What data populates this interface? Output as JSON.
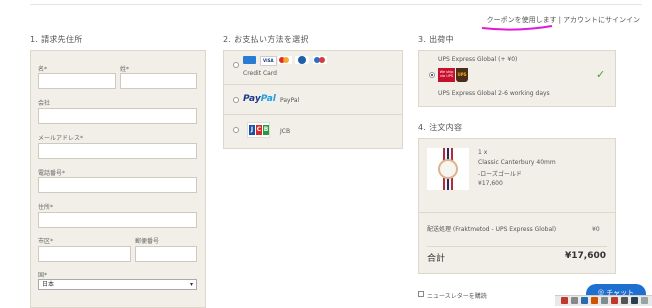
{
  "top_links": {
    "coupon": "クーポンを使用します",
    "separator": "|",
    "signin": "アカウントにサインイン"
  },
  "sections": {
    "billing": "1. 請求先住所",
    "payment": "2. お支払い方法を選択",
    "shipping": "3. 出荷中",
    "order": "4. 注文内容"
  },
  "billing_form": {
    "first_name": "名*",
    "last_name": "姓*",
    "company": "会社",
    "email": "メールアドレス*",
    "phone": "電話番号*",
    "address": "住所*",
    "city": "市区*",
    "zip": "郵便番号",
    "country": "国*",
    "country_value": "日本"
  },
  "payment_options": [
    {
      "label": "Credit Card",
      "selected": false,
      "logos": [
        "amex-icon",
        "visa-icon",
        "mastercard-icon",
        "diners-icon",
        "jcb-mini-icon"
      ]
    },
    {
      "label": "PayPal",
      "logo_text": "PayPal",
      "selected": false
    },
    {
      "label": "JCB",
      "logo_text": "JCB",
      "selected": false
    }
  ],
  "shipping": {
    "method_title": "UPS Express Global (+ ¥0)",
    "detail": "UPS Express Global 2-6 working days",
    "badge_text": "We ship via UPS",
    "ups_text": "UPS",
    "check": "✓"
  },
  "order": {
    "qty": "1 x",
    "product_name": "Classic Canterbury 40mm",
    "variant": "-ローズゴールド",
    "price": "¥17,600",
    "shipping_label": "配送処理 (Fraktmetod - UPS Express Global)",
    "shipping_price": "¥0",
    "total_label": "合計",
    "total_value": "¥17,600"
  },
  "newsletter": "ニュースレターを購読",
  "chat_label": "チャット",
  "colors": {
    "accent": "#1f6fd1",
    "underline": "#e01ad6",
    "check": "#4a9a3a"
  }
}
